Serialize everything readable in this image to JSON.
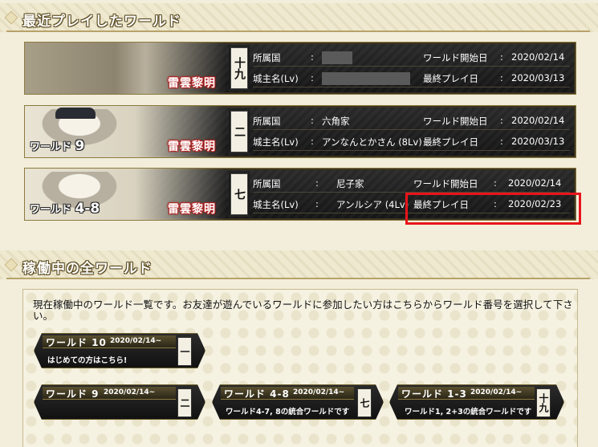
{
  "recent": {
    "title": "最近プレイしたワールド",
    "logo": "雷雲黎明",
    "labels": {
      "country": "所属国",
      "lord": "城主名(Lv)",
      "start": "ワールド開始日",
      "last": "最終プレイ日",
      "colon": ":"
    },
    "worlds": [
      {
        "world_label": "",
        "world_num": "",
        "scroll": "十九",
        "country": "",
        "lord": "",
        "start": "2020/02/14",
        "last": "2020/03/13",
        "masked": true
      },
      {
        "world_label": "ワールド",
        "world_num": "9",
        "scroll": "二",
        "country": "六角家",
        "lord": "アンなんとかさん (8Lv)",
        "start": "2020/02/14",
        "last": "2020/03/13",
        "masked": false
      },
      {
        "world_label": "ワールド",
        "world_num": "4-8",
        "scroll": "七",
        "country": "尼子家",
        "lord": "アンルシア (4Lv)",
        "start": "2020/02/14",
        "last": "2020/02/23",
        "masked": false
      }
    ]
  },
  "active": {
    "title": "稼働中の全ワールド",
    "description": "現在稼働中のワールド一覧です。お友達が遊んでいるワールドに参加したい方はこちらからワールド番号を選択して下さい。",
    "buttons": [
      {
        "name": "ワールド 10",
        "date": "2020/02/14~",
        "sub": "はじめての方はこちら!",
        "scroll": "一"
      },
      {
        "name": "ワールド 9",
        "date": "2020/02/14~",
        "sub": "",
        "scroll": "二"
      },
      {
        "name": "ワールド 4-8",
        "date": "2020/02/14~",
        "sub": "ワールド4-7, 8の統合ワールドです",
        "scroll": "七"
      },
      {
        "name": "ワールド 1-3",
        "date": "2020/02/14~",
        "sub": "ワールド1, 2+3の統合ワールドです",
        "scroll": "十九"
      }
    ]
  },
  "colors": {
    "highlight": "#e8141b",
    "background": "#f2eedb",
    "card": "#1a1a1a",
    "accent": "#b32020"
  }
}
